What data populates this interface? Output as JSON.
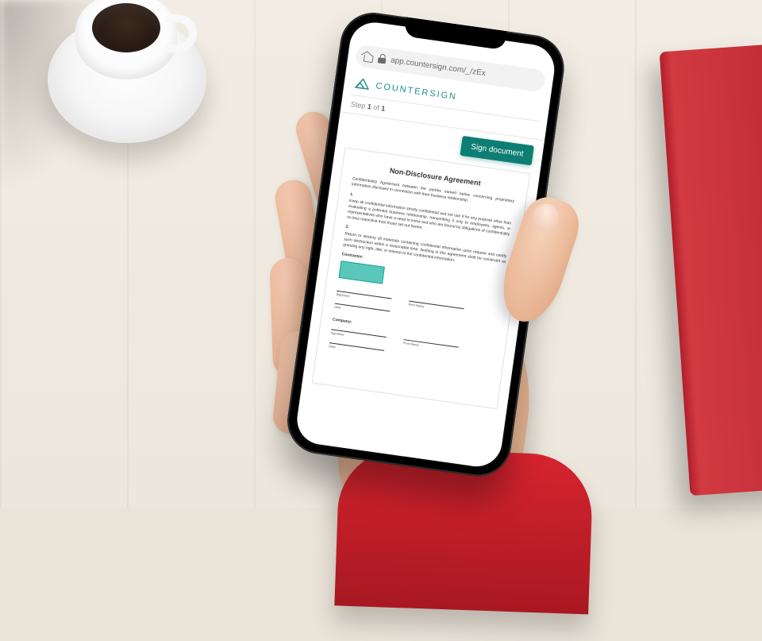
{
  "browser": {
    "url": "app.countersign.com/_/zEx"
  },
  "brand": {
    "name": "COUNTERSIGN"
  },
  "step": {
    "prefix": "Step",
    "current": "1",
    "of": "of",
    "total": "1"
  },
  "actions": {
    "sign": "Sign document"
  },
  "document": {
    "title": "Non-Disclosure Agreement",
    "intro": "Confidentiality Agreement between the parties named below concerning proprietary information disclosed in connection with their business relationship.",
    "clause1_num": "1.",
    "clause1": "Keep all confidential information strictly confidential and not use it for any purpose other than evaluating a potential business relationship, transmitting it only to employees, agents, or representatives who have a need to know and who are bound by obligations of confidentiality no less restrictive than those set out herein.",
    "clause2_num": "2.",
    "clause2": "Return or destroy all materials containing confidential information upon request and certify such destruction within a reasonable time. Nothing in this agreement shall be construed as granting any right, title, or interest to the confidential information.",
    "party_a_label": "Contractor:",
    "party_b_label": "Company:",
    "sig_label": "Signature",
    "name_label": "Print Name",
    "date_label": "Date"
  }
}
